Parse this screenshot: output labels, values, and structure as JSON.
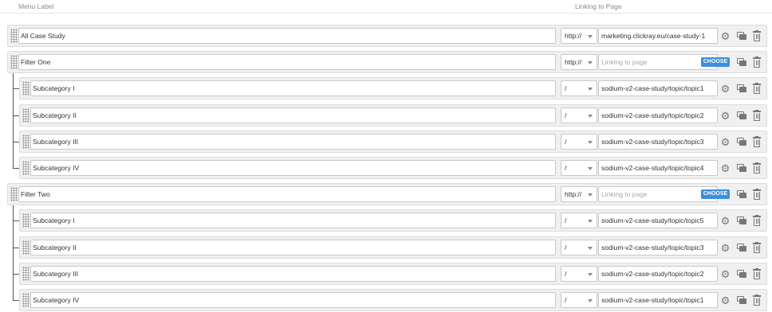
{
  "header": {
    "menu_label": "Menu Label",
    "linking_label": "Linking to Page"
  },
  "buttons": {
    "choose": "CHOOSE"
  },
  "items": [
    {
      "label": "All Case Study",
      "protocol": "http://",
      "url": "marketing.clickray.eu/case-study-1",
      "placeholder": false,
      "level": 0
    },
    {
      "label": "Filter One",
      "protocol": "http://",
      "url": "Linking to page",
      "placeholder": true,
      "level": 0
    },
    {
      "label": "Subcategory I",
      "protocol": "/",
      "url": "sodium-v2-case-study/topic/topic1",
      "placeholder": false,
      "level": 1
    },
    {
      "label": "Subcategory II",
      "protocol": "/",
      "url": "sodium-v2-case-study/topic/topic2",
      "placeholder": false,
      "level": 1
    },
    {
      "label": "Subcategory III",
      "protocol": "/",
      "url": "sodium-v2-case-study/topic/topic3",
      "placeholder": false,
      "level": 1
    },
    {
      "label": "Subcategory IV",
      "protocol": "/",
      "url": "sodium-v2-case-study/topic/topic4",
      "placeholder": false,
      "level": 1
    },
    {
      "label": "Filter Two",
      "protocol": "http://",
      "url": "Linking to page",
      "placeholder": true,
      "level": 0
    },
    {
      "label": "Subcategory I",
      "protocol": "/",
      "url": "sodium-v2-case-study/topic/topic5",
      "placeholder": false,
      "level": 1
    },
    {
      "label": "Subcategory II",
      "protocol": "/",
      "url": "sodium-v2-case-study/topic/topic3",
      "placeholder": false,
      "level": 1
    },
    {
      "label": "Subcategory III",
      "protocol": "/",
      "url": "sodium-v2-case-study/topic/topic2",
      "placeholder": false,
      "level": 1
    },
    {
      "label": "Subcategory IV",
      "protocol": "/",
      "url": "sodium-v2-case-study/topic/topic1",
      "placeholder": false,
      "level": 1
    }
  ],
  "colors": {
    "choose_button": "#3c8fdc",
    "row_background": "#f0f0f0"
  },
  "icons": [
    "drag-handle-icon",
    "chevron-down-icon",
    "gear-icon",
    "copy-icon",
    "trash-icon"
  ]
}
